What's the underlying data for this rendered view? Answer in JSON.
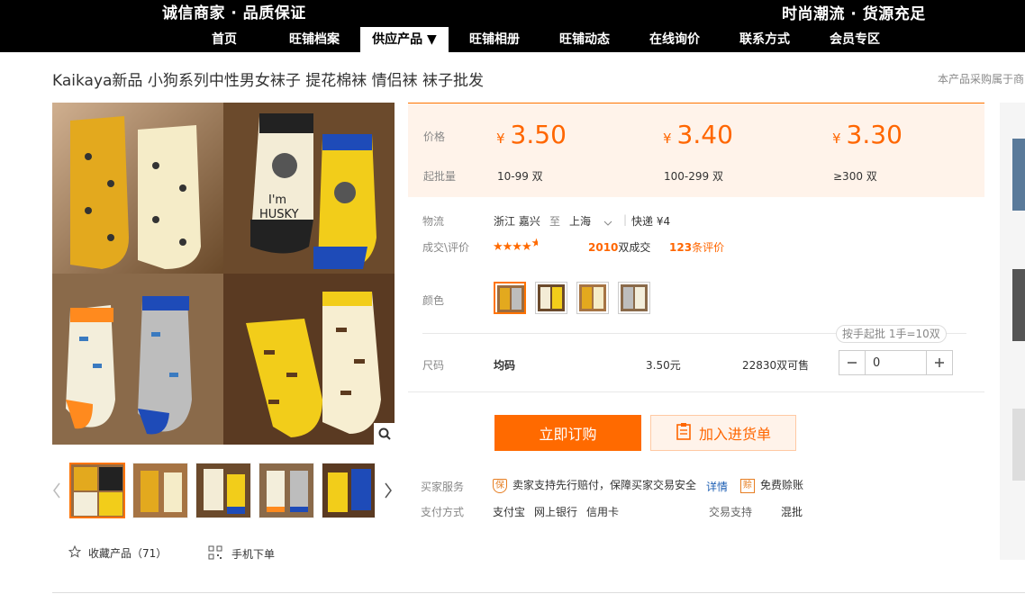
{
  "header": {
    "slogan_left": "诚信商家 · 品质保证",
    "slogan_right": "时尚潮流 · 货源充足",
    "nav": [
      "首页",
      "旺铺档案",
      "供应产品 ▼",
      "旺铺相册",
      "旺铺动态",
      "在线询价",
      "联系方式",
      "会员专区"
    ],
    "active_nav": "供应产品 ▼"
  },
  "product": {
    "title": "Kaikaya新品 小狗系列中性男女袜子 提花棉袜 情侣袜 袜子批发",
    "note": "本产品采购属于商"
  },
  "pricing": {
    "price_label": "价格",
    "moq_label": "起批量",
    "currency": "¥",
    "tiers": [
      {
        "price": "3.50",
        "range": "10-99 双"
      },
      {
        "price": "3.40",
        "range": "100-299 双"
      },
      {
        "price": "3.30",
        "range": "≥300 双"
      }
    ]
  },
  "logistics": {
    "label": "物流",
    "from": "浙江 嘉兴",
    "to_word": "至",
    "to": "上海",
    "shipping": "快递 ¥4"
  },
  "deals": {
    "label": "成交\\评价",
    "rating": 4.5,
    "sold_count": "2010",
    "sold_suffix": "双成交",
    "review_count": "123",
    "review_suffix": "条评价"
  },
  "color": {
    "label": "颜色",
    "option_count": 4,
    "selected_index": 0
  },
  "size": {
    "label": "尺码",
    "tip": "按手起批 1手=10双",
    "name": "均码",
    "price": "3.50元",
    "stock": "22830双可售",
    "quantity": "0"
  },
  "actions": {
    "buy": "立即订购",
    "add_cart": "加入进货单"
  },
  "services": {
    "buyer_label": "买家服务",
    "guarantee": "卖家支持先行赔付，保障买家交易安全",
    "detail_link": "详情",
    "free_icon_text": "赊",
    "free": "免费赊账",
    "guarantee_icon_text": "保",
    "pay_label": "支付方式",
    "pay_methods": [
      "支付宝",
      "网上银行",
      "信用卡"
    ],
    "trade_label": "交易支持",
    "trade_value": "混批"
  },
  "gallery": {
    "favorite_label": "收藏产品（71）",
    "mobile_label": "手机下单",
    "thumb_count": 5
  },
  "colors": {
    "accent": "#ff6a00",
    "price_bg": "#fff3ea",
    "header_bg": "#000000"
  }
}
